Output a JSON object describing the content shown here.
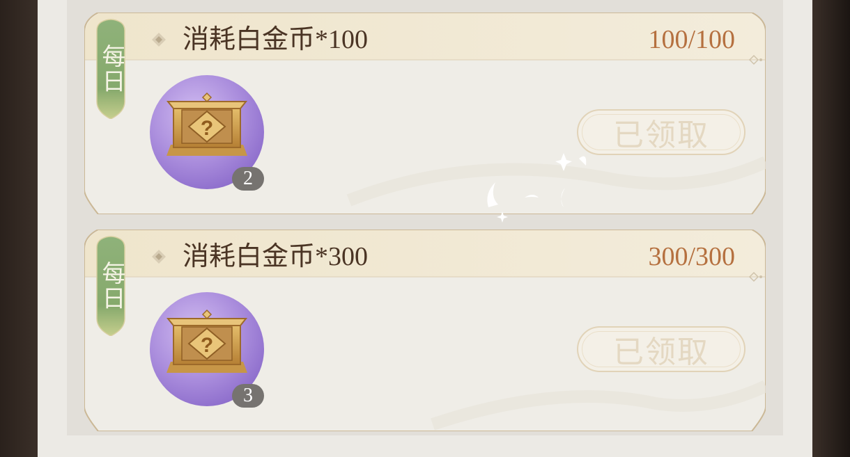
{
  "tasks": [
    {
      "tag": "每日",
      "title": "消耗白金币*100",
      "progress": "100/100",
      "reward": {
        "icon": "mystery-chest-icon",
        "count": "2"
      },
      "claim_label": "已领取",
      "claimed": true
    },
    {
      "tag": "每日",
      "title": "消耗白金币*300",
      "progress": "300/300",
      "reward": {
        "icon": "mystery-chest-icon",
        "count": "3"
      },
      "claim_label": "已领取",
      "claimed": true
    }
  ],
  "colors": {
    "title": "#4a3424",
    "progress": "#b5703f",
    "tag_green": "#8fae74",
    "reward_bg": "#a88ad9",
    "claimed_button_text": "#e4d8c2"
  }
}
